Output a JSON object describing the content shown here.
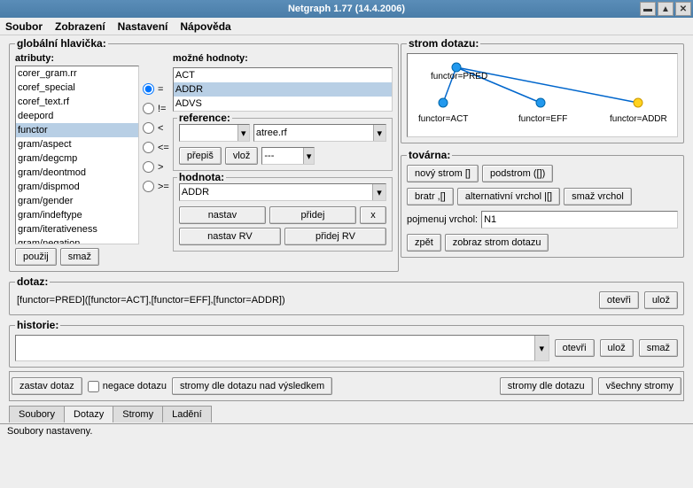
{
  "title": "Netgraph 1.77 (14.4.2006)",
  "menus": {
    "soubor": "Soubor",
    "zobrazeni": "Zobrazení",
    "nastaveni": "Nastavení",
    "napoveda": "Nápověda"
  },
  "gh": {
    "legend": "globální hlavička:",
    "atributy_label": "atributy:",
    "atributy": [
      "corer_gram.rr",
      "coref_special",
      "coref_text.rf",
      "deepord",
      "functor",
      "gram/aspect",
      "gram/degcmp",
      "gram/deontmod",
      "gram/dispmod",
      "gram/gender",
      "gram/indeftype",
      "gram/iterativeness",
      "gram/negation"
    ],
    "atributy_selected": "functor",
    "pouzij": "použij",
    "smaz": "smaž",
    "ops": [
      "=",
      "!=",
      "<",
      "<=",
      ">",
      ">="
    ],
    "op_selected": "=",
    "mozne_label": "možné hodnoty:",
    "mozne": [
      "ACT",
      "ADDR",
      "ADVS"
    ],
    "mozne_selected": "ADDR",
    "reference_label": "reference:",
    "ref2": "atree.rf",
    "prepis": "přepiš",
    "vloz": "vlož",
    "dashes": "---",
    "hodnota_label": "hodnota:",
    "hodnota_value": "ADDR",
    "nastav": "nastav",
    "pridej": "přidej",
    "x": "x",
    "nastav_rv": "nastav RV",
    "pridej_rv": "přidej RV"
  },
  "strom": {
    "legend": "strom dotazu:",
    "root": "functor=PRED",
    "c1": "functor=ACT",
    "c2": "functor=EFF",
    "c3": "functor=ADDR"
  },
  "tovarna": {
    "legend": "továrna:",
    "novy": "nový strom []",
    "podstrom": "podstrom ([])",
    "bratr": "bratr ,[]",
    "alt": "alternativní vrchol |[]",
    "smazv": "smaž vrchol",
    "pojmenuj_label": "pojmenuj vrchol:",
    "pojmenuj_value": "N1",
    "zpet": "zpět",
    "zobraz": "zobraz strom dotazu"
  },
  "dotaz": {
    "legend": "dotaz:",
    "text": "[functor=PRED]([functor=ACT],[functor=EFF],[functor=ADDR])",
    "otevri": "otevři",
    "uloz": "ulož"
  },
  "historie": {
    "legend": "historie:",
    "otevri": "otevři",
    "uloz": "ulož",
    "smaz": "smaž"
  },
  "bottom": {
    "zastav": "zastav dotaz",
    "negace": "negace dotazu",
    "stromy_vysl": "stromy dle dotazu nad výsledkem",
    "stromy_dle": "stromy dle dotazu",
    "vsechny": "všechny stromy"
  },
  "tabs": {
    "soubory": "Soubory",
    "dotazy": "Dotazy",
    "stromy": "Stromy",
    "ladeni": "Ladění"
  },
  "status": "Soubory nastaveny."
}
